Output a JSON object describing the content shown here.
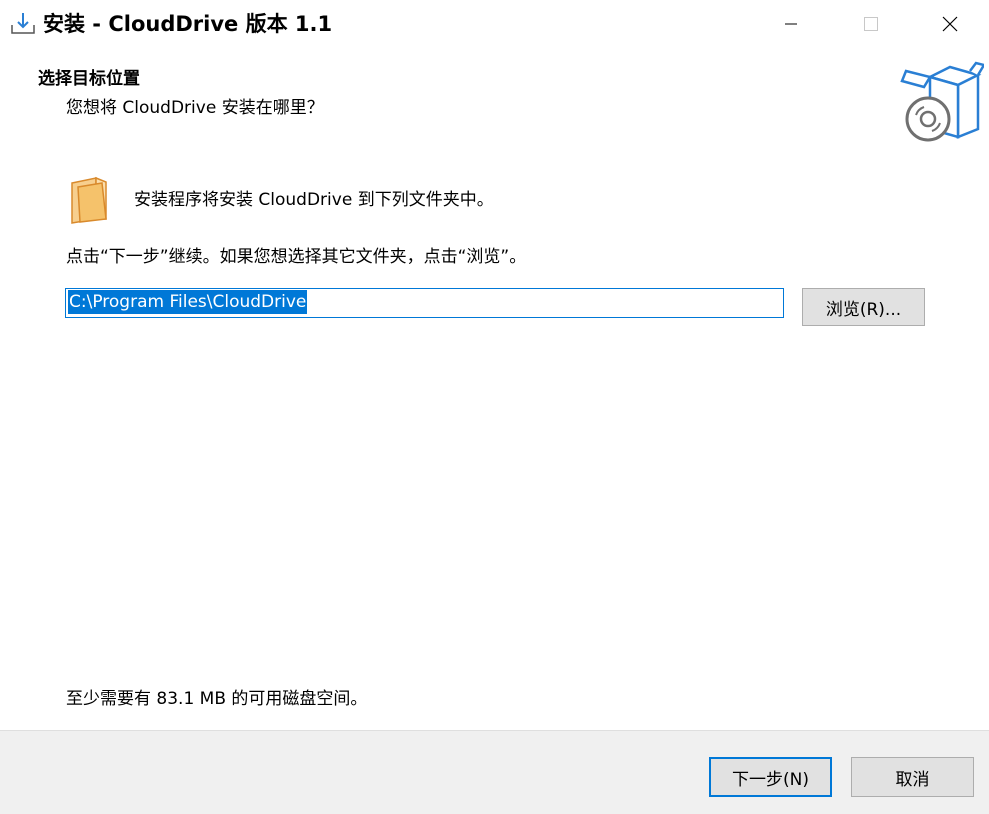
{
  "window": {
    "title": "安装 - CloudDrive 版本 1.1",
    "controls": [
      "minimize-icon",
      "maximize-icon",
      "close-icon"
    ]
  },
  "header": {
    "title": "选择目标位置",
    "subtitle": "您想将 CloudDrive 安装在哪里？",
    "image": "install-box-disc-icon"
  },
  "body": {
    "info_text": "安装程序将安装 CloudDrive 到下列文件夹中。",
    "hint_text": "点击“下一步”继续。如果您想选择其它文件夹，点击“浏览”。",
    "path_value": "C:\\Program Files\\CloudDrive",
    "browse_label": "浏览(R)...",
    "space_text": "至少需要有 83.1 MB 的可用磁盘空间。"
  },
  "footer": {
    "next_label": "下一步(N)",
    "cancel_label": "取消"
  },
  "colors": {
    "accent": "#0078d7",
    "footer_bg": "#f0f0f0",
    "button_bg": "#e1e1e1",
    "folder": "#f5c26b"
  }
}
